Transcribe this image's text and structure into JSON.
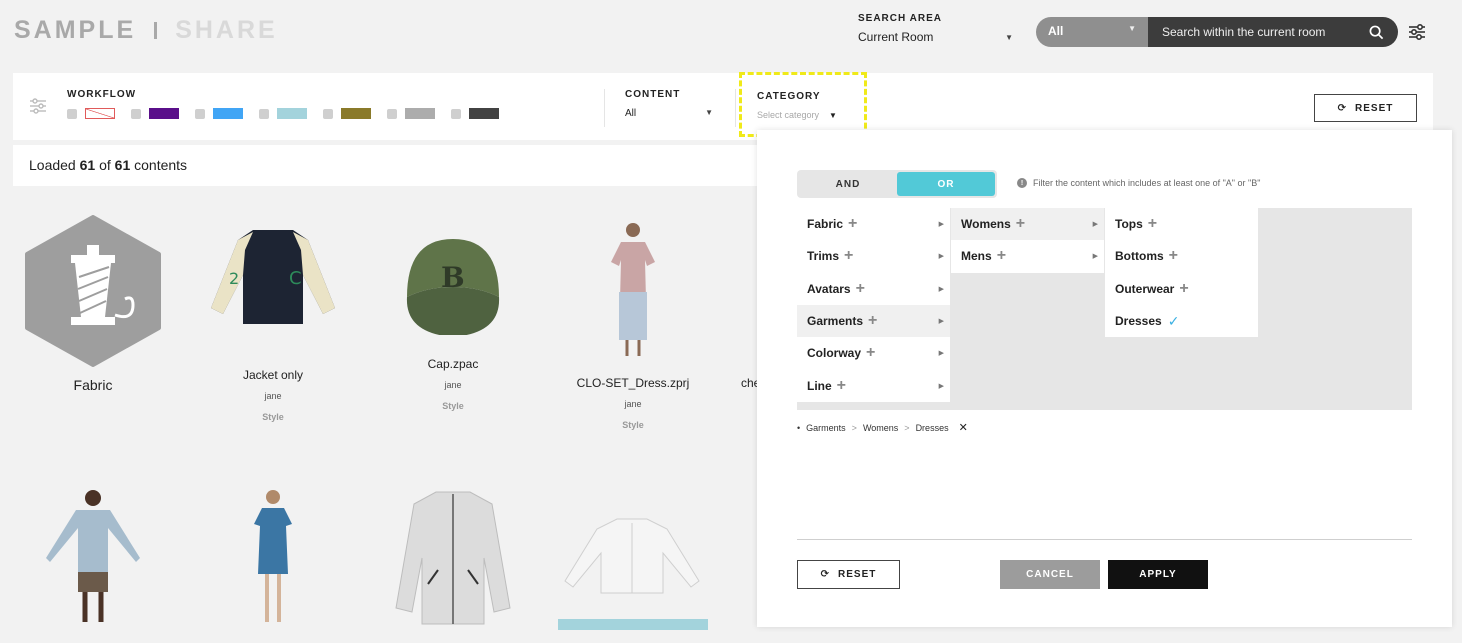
{
  "brand": {
    "part1": "SAMPLE",
    "part2": "SHARE"
  },
  "search_area": {
    "label": "SEARCH AREA",
    "value": "Current Room"
  },
  "search": {
    "scope": "All",
    "placeholder": "Search within the current room"
  },
  "filters": {
    "workflow_label": "WORKFLOW",
    "workflow_colors": [
      "none",
      "#5a0f8a",
      "#41a5f5",
      "#a3d3dc",
      "#8a7a2a",
      "#acacac",
      "#424242"
    ],
    "content_label": "CONTENT",
    "content_value": "All",
    "category_label": "CATEGORY",
    "category_placeholder": "Select category",
    "reset": "RESET"
  },
  "loaded": {
    "prefix": "Loaded",
    "count": "61",
    "of": "of",
    "total": "61",
    "suffix": "contents"
  },
  "cards": [
    {
      "title": "Fabric"
    },
    {
      "title": "Jacket only",
      "owner": "jane",
      "type": "Style"
    },
    {
      "title": "Cap.zpac",
      "owner": "jane",
      "type": "Style"
    },
    {
      "title": "CLO-SET_Dress.zprj",
      "owner": "jane",
      "type": "Style"
    },
    {
      "title": "che"
    }
  ],
  "popup": {
    "and": "AND",
    "or": "OR",
    "hint": "Filter the content which includes at least one of \"A\" or \"B\"",
    "col1": [
      "Fabric",
      "Trims",
      "Avatars",
      "Garments",
      "Colorway",
      "Line"
    ],
    "col2": [
      "Womens",
      "Mens"
    ],
    "col3": [
      "Tops",
      "Bottoms",
      "Outerwear",
      "Dresses"
    ],
    "crumbs": [
      "Garments",
      "Womens",
      "Dresses"
    ],
    "reset": "RESET",
    "cancel": "CANCEL",
    "apply": "APPLY"
  }
}
